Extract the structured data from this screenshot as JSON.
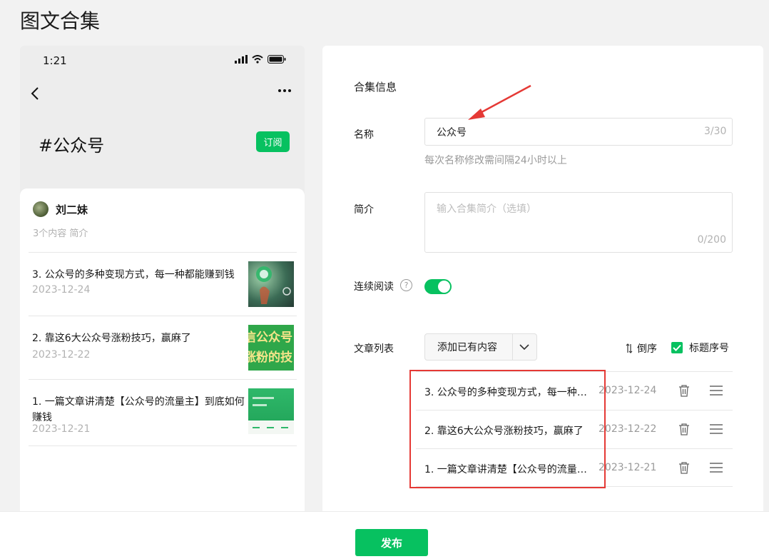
{
  "page": {
    "title": "图文合集"
  },
  "phone": {
    "time": "1:21",
    "hashtag": "#公众号",
    "subscribe_label": "订阅",
    "author_name": "刘二妹",
    "author_meta": "3个内容  简介",
    "articles": [
      {
        "title": "3. 公众号的多种变现方式，每一种都能赚到钱",
        "date": "2023-12-24"
      },
      {
        "title": "2. 靠这6大公众号涨粉技巧，赢麻了",
        "date": "2023-12-22",
        "thumb_text": "信公众号\n涨粉的技"
      },
      {
        "title": "1. 一篇文章讲清楚【公众号的流量主】到底如何赚钱",
        "date": "2023-12-21"
      }
    ]
  },
  "panel": {
    "section_title": "合集信息",
    "name_label": "名称",
    "name_value": "公众号",
    "name_count": "3/30",
    "name_hint": "每次名称修改需间隔24小时以上",
    "intro_label": "简介",
    "intro_placeholder": "输入合集简介（选填）",
    "intro_count": "0/200",
    "continuous_label": "连续阅读",
    "continuous_on": true,
    "list_label": "文章列表",
    "add_existing_label": "添加已有内容",
    "reverse_label": "倒序",
    "seq_label": "标题序号",
    "seq_checked": true,
    "rows": [
      {
        "title": "3. 公众号的多种变现方式，每一种都能赚到钱",
        "date": "2023-12-24"
      },
      {
        "title": "2. 靠这6大公众号涨粉技巧，赢麻了",
        "date": "2023-12-22"
      },
      {
        "title": "1. 一篇文章讲清楚【公众号的流量主】到底如何赚钱",
        "date": "2023-12-21"
      }
    ]
  },
  "footer": {
    "publish_label": "发布"
  },
  "colors": {
    "accent": "#07c160",
    "annotation": "#e53935"
  }
}
